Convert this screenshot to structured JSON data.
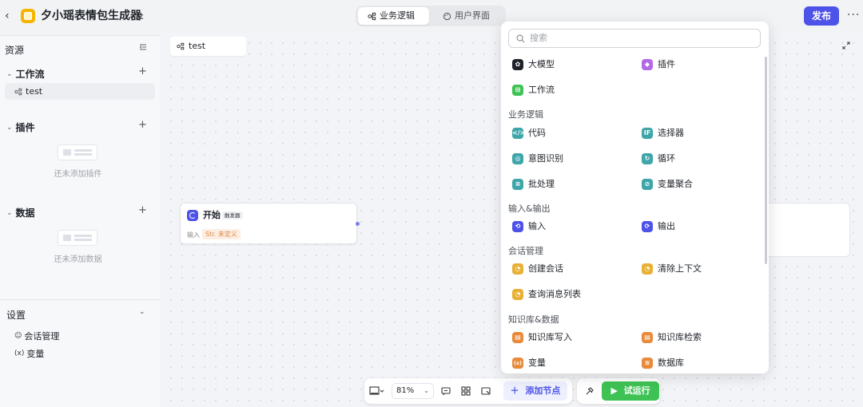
{
  "header": {
    "back_icon": "chevron-left-icon",
    "app_title": "夕小瑶表情包生成器",
    "tabs": [
      {
        "label": "业务逻辑",
        "icon": "workflow-icon",
        "active": true
      },
      {
        "label": "用户界面",
        "icon": "palette-icon",
        "active": false
      }
    ],
    "publish_label": "发布",
    "more_icon": "more-dots-icon",
    "accent": "#4d53e8"
  },
  "sidebar": {
    "title": "资源",
    "sections": {
      "workflow": {
        "title": "工作流",
        "items": [
          {
            "label": "test"
          }
        ]
      },
      "plugin": {
        "title": "插件",
        "empty": "还未添加插件"
      },
      "data": {
        "title": "数据",
        "empty": "还未添加数据"
      }
    },
    "settings": {
      "title": "设置",
      "items": [
        {
          "label": "会话管理",
          "icon": "chat-manage-icon"
        },
        {
          "label": "变量",
          "icon": "variable-icon",
          "glyph": "(x)"
        }
      ]
    }
  },
  "canvas": {
    "tab_label": "test",
    "start_node": {
      "title": "开始",
      "tag": "触发器",
      "input_label": "输入",
      "input_value_prefix": "Str.",
      "input_value": "未定义"
    }
  },
  "toolbar": {
    "zoom": "81%",
    "add_node_label": "添加节点",
    "run_label": "试运行",
    "run_color": "#3ec254"
  },
  "picker": {
    "search_placeholder": "搜索",
    "top_items": [
      {
        "label": "大模型",
        "color": "#1f2329",
        "icon": "llm-icon"
      },
      {
        "label": "插件",
        "color": "#b368e8",
        "icon": "plugin-icon"
      },
      {
        "label": "工作流",
        "color": "#3ec254",
        "icon": "workflow-node-icon"
      }
    ],
    "groups": [
      {
        "title": "业务逻辑",
        "items": [
          {
            "label": "代码",
            "color": "#3ea6a9",
            "glyph": "</>"
          },
          {
            "label": "选择器",
            "color": "#3ea6a9",
            "glyph": "IF"
          },
          {
            "label": "意图识别",
            "color": "#3ea6a9",
            "glyph": "◎"
          },
          {
            "label": "循环",
            "color": "#3ea6a9",
            "glyph": "↻"
          },
          {
            "label": "批处理",
            "color": "#3ea6a9",
            "glyph": "≡"
          },
          {
            "label": "变量聚合",
            "color": "#3ea6a9",
            "glyph": "⊘"
          }
        ]
      },
      {
        "title": "输入&输出",
        "items": [
          {
            "label": "输入",
            "color": "#4d53e8",
            "glyph": "⟲"
          },
          {
            "label": "输出",
            "color": "#4d53e8",
            "glyph": "⟳"
          }
        ]
      },
      {
        "title": "会话管理",
        "items": [
          {
            "label": "创建会话",
            "color": "#e8b136",
            "glyph": "◔"
          },
          {
            "label": "清除上下文",
            "color": "#e8b136",
            "glyph": "◔"
          },
          {
            "label": "查询消息列表",
            "color": "#e8b136",
            "glyph": "◔"
          }
        ]
      },
      {
        "title": "知识库&数据",
        "items": [
          {
            "label": "知识库写入",
            "color": "#e88a3a",
            "glyph": "▤"
          },
          {
            "label": "知识库检索",
            "color": "#e88a3a",
            "glyph": "▤"
          },
          {
            "label": "变量",
            "color": "#e88a3a",
            "glyph": "(x)"
          },
          {
            "label": "数据库",
            "color": "#e88a3a",
            "glyph": "≋"
          }
        ]
      }
    ]
  }
}
